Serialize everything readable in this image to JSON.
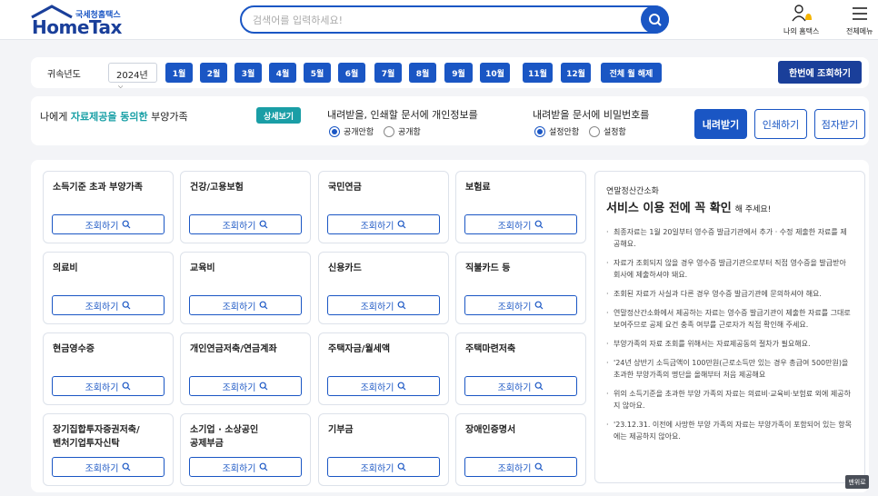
{
  "brand": {
    "sub": "국세청홈택스",
    "main": "HomeTax"
  },
  "search": {
    "placeholder": "검색어를 입력하세요!"
  },
  "header_menu": {
    "my_label": "나의 홈택스",
    "all_label": "전체메뉴"
  },
  "filter": {
    "year_label": "귀속년도",
    "year_value": "2024년",
    "months": [
      "1월",
      "2월",
      "3월",
      "4월",
      "5월",
      "6월",
      "7월",
      "8월",
      "9월",
      "10월",
      "11월",
      "12월",
      "전체 월 해제"
    ],
    "query_all_label": "한번에 조회하기"
  },
  "options": {
    "consent": {
      "pre": "나에게 ",
      "highlight": "자료제공을 동의한",
      "post": " 부양가족",
      "detail_label": "상세보기"
    },
    "privacy": {
      "title": "내려받을, 인쇄할 문서에 개인정보를",
      "opt1": "공개안함",
      "opt2": "공개함"
    },
    "password": {
      "title": "내려받을 문서에 비밀번호를",
      "opt1": "설정안함",
      "opt2": "설정함"
    },
    "download_label": "내려받기",
    "print_label": "인쇄하기",
    "email_label": "점자받기"
  },
  "cards": [
    {
      "title": "소득기준 초과 부양가족",
      "button": "조회하기"
    },
    {
      "title": "건강/고용보험",
      "button": "조회하기"
    },
    {
      "title": "국민연금",
      "button": "조회하기"
    },
    {
      "title": "보험료",
      "button": "조회하기"
    },
    {
      "title": "의료비",
      "button": "조회하기"
    },
    {
      "title": "교육비",
      "button": "조회하기"
    },
    {
      "title": "신용카드",
      "button": "조회하기"
    },
    {
      "title": "직불카드 등",
      "button": "조회하기"
    },
    {
      "title": "현금영수증",
      "button": "조회하기"
    },
    {
      "title": "개인연금저축/연금계좌",
      "button": "조회하기"
    },
    {
      "title": "주택자금/월세액",
      "button": "조회하기"
    },
    {
      "title": "주택마련저축",
      "button": "조회하기"
    },
    {
      "title": "장기집합투자증권저축/\n벤처기업투자신탁",
      "button": "조회하기"
    },
    {
      "title": "소기업 · 소상공인\n공제부금",
      "button": "조회하기"
    },
    {
      "title": "기부금",
      "button": "조회하기"
    },
    {
      "title": "장애인증명서",
      "button": "조회하기"
    }
  ],
  "notice": {
    "subtitle": "연말정산간소화",
    "title": "서비스 이용 전에 꼭 확인",
    "title_suffix": "해 주세요!",
    "items": [
      "최종자료는 1월 20일부터 영수증 발급기관에서 추가 · 수정 제출한 자료를 제공해요.",
      "자료가 조회되지 않을 경우 영수증 발급기관으로부터 직접 영수증을 발급받아 회사에 제출하셔야 돼요.",
      "조회된 자료가 사실과 다른 경우 영수증 발급기관에 문의하셔야 해요.",
      "연말정산간소화에서 제공하는 자료는 영수증 발급기관이 제출한 자료를 그대로 보여주므로 공제 요건 충족 여부를 근로자가 직접 확인해 주세요.",
      "부양가족의 자료 조회를 위해서는 자료제공동의 절차가 필요해요.",
      "'24년 상반기 소득금액이 100만원(근로소득만 있는 경우 총급여 500만원)을 초과한 부양가족의 명단을 올해부터 처음 제공해요",
      "위의 소득기준을 초과한 부양 가족의 자료는 의료비·교육비·보험료 외에 제공하지 않아요.",
      "'23.12.31. 이전에 사망한 부양 가족의 자료는 부양가족이 포함되어 있는 항목에는 제공하지 않아요."
    ]
  },
  "totop_label": "맨위로",
  "colors": {
    "primary": "#1a56c4",
    "navy": "#1a3f9a",
    "teal": "#1a9ea6"
  }
}
